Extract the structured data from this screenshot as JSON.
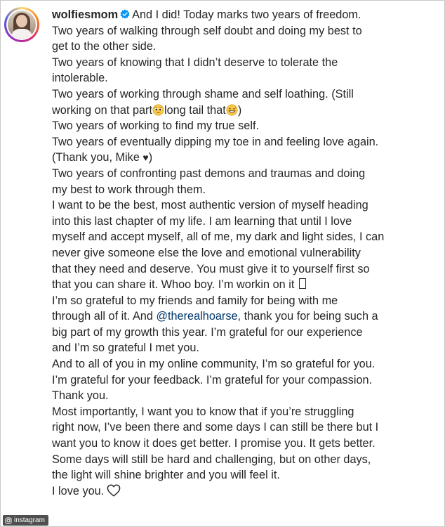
{
  "post": {
    "username": "wolfiesmom",
    "verified_icon": "verified-badge-icon",
    "colors": {
      "text": "#262626",
      "mention": "#00376b",
      "verified": "#0095f6"
    },
    "line_01_text": "And I did! Today marks two years of freedom.",
    "line_02": "Two years of walking through self doubt and doing my best to",
    "line_03": "get to the other side.",
    "line_04": "Two years of knowing that I didn’t deserve to tolerate the",
    "line_05": "intolerable.",
    "line_06": "Two years of working through shame and self loathing. (Still",
    "line_07_a": "working on that part",
    "line_07_b": "long tail that",
    "line_07_c": ")",
    "line_08": "Two years of working to find my true self.",
    "line_09": "Two years of eventually dipping my toe in and feeling love again.",
    "line_10_a": "(Thank you, Mike ",
    "line_10_heart": "♥",
    "line_10_b": ")",
    "line_11": "Two years of confronting past demons and traumas and doing",
    "line_12": "my best to work through them.",
    "line_13": "I want to be the best, most authentic version of myself heading",
    "line_14": "into this last chapter of my life. I am learning that until I love",
    "line_15": "myself and accept myself, all of me, my dark and light sides, I can",
    "line_16": "never give someone else the love and emotional vulnerability",
    "line_17": "that they need and deserve. You must give it to yourself first so",
    "line_18": "that you can share it. Whoo boy. I’m workin on it",
    "line_19": "I’m so grateful to my friends and family for being with me",
    "line_20_a": "through all of it. And ",
    "line_20_mention": "@therealhoarse",
    "line_20_b": ", thank you for being such a",
    "line_21": "big part of my growth this year. I’m grateful for our experience",
    "line_22": "and I’m so grateful I met you.",
    "line_23": "And to all of you in my online community, I’m so grateful for you.",
    "line_24": "I’m grateful for your feedback. I’m grateful for your compassion.",
    "line_25": "Thank you.",
    "line_26": "Most importantly, I want you to know that if you’re struggling",
    "line_27": "right now, I’ve been there and some days I can still be there but I",
    "line_28": "want you to know it does get better. I promise you. It gets better.",
    "line_29": "Some days will still be hard and challenging, but on other days,",
    "line_30": "the light will shine brighter and you will feel it.",
    "line_31": "I love you.",
    "icons": {
      "emoji_1": "pleading-face-emoji",
      "emoji_2": "grinning-sweat-emoji",
      "emoji_3": "unrendered-emoji-box",
      "final_heart": "white-heart-icon"
    }
  },
  "watermark": {
    "label": "instagram",
    "icon": "instagram-icon"
  }
}
